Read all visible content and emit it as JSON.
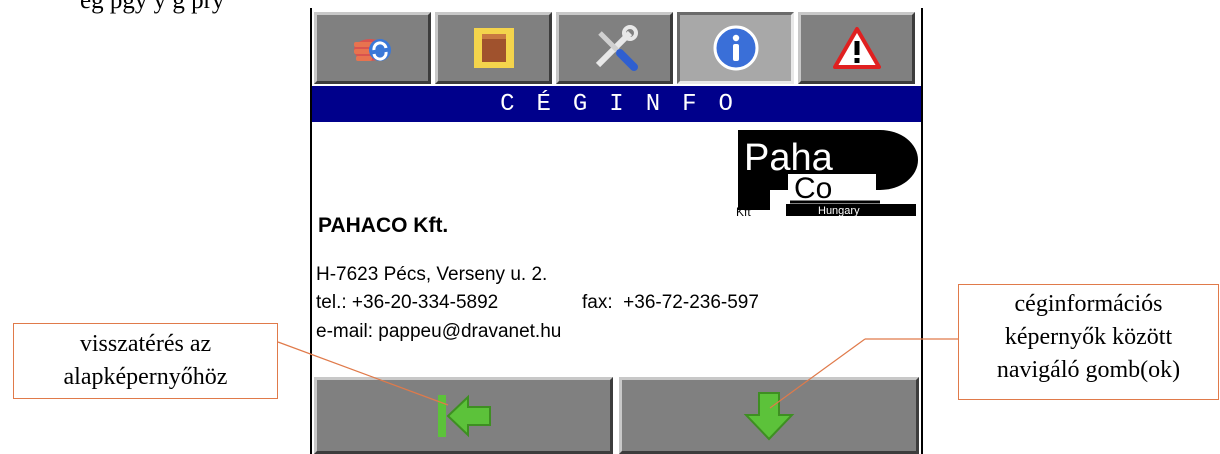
{
  "document": {
    "top_text": "ég pgy  y                                              g                                 pry"
  },
  "tabs": [
    {
      "icon": "hand-refresh-icon"
    },
    {
      "icon": "package-box-icon"
    },
    {
      "icon": "tools-icon"
    },
    {
      "icon": "info-icon",
      "active": true
    },
    {
      "icon": "warning-icon"
    }
  ],
  "screen": {
    "title": "CÉGINFO",
    "logo": {
      "line1": "Paha",
      "line2": "Co",
      "kft": "Kft",
      "country": "Hungary"
    },
    "company_name": "PAHACO Kft.",
    "address": "H-7623 Pécs, Verseny u. 2.",
    "tel": "tel.: +36-20-334-5892",
    "fax": "fax:  +36-72-236-597",
    "email": "e-mail: pappeu@dravanet.hu"
  },
  "buttons": {
    "back": {
      "icon": "back-to-home-arrow-icon"
    },
    "next": {
      "icon": "down-arrow-icon"
    }
  },
  "callouts": {
    "left": [
      "visszatérés az",
      "alapképernyőhöz"
    ],
    "right": [
      "céginformációs",
      "képernyők között",
      "navigáló gomb(ok)"
    ]
  },
  "colors": {
    "title_bar": "#00008b",
    "button_gray": "#808080",
    "callout_border": "#e07a4a",
    "arrow_green": "#5cc23a"
  }
}
